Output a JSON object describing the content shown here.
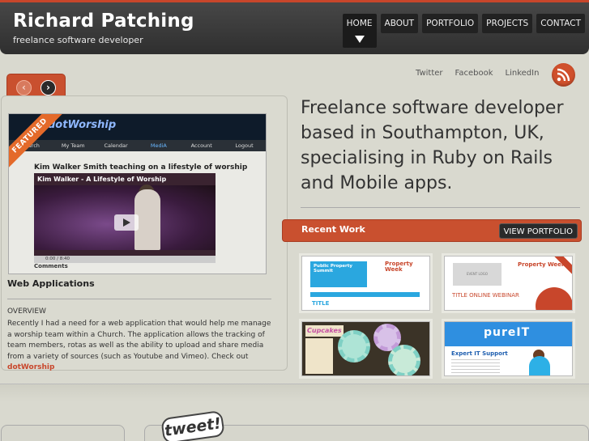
{
  "header": {
    "title": "Richard Patching",
    "subtitle": "freelance software developer",
    "nav": [
      "HOME",
      "ABOUT",
      "PORTFOLIO",
      "PROJECTS",
      "CONTACT"
    ]
  },
  "social": {
    "twitter": "Twitter",
    "facebook": "Facebook",
    "linkedin": "LinkedIn",
    "rss_icon": "rss-icon"
  },
  "slider": {
    "prev_icon": "chevron-left-icon",
    "next_icon": "chevron-right-icon"
  },
  "featured": {
    "ribbon": "FEATURED",
    "screenshot": {
      "brand": "dotWorship",
      "menu": [
        "Church",
        "My Team",
        "Calendar",
        "MediA",
        "Account",
        "Logout"
      ],
      "headline": "Kim Walker Smith teaching on a lifestyle of worship",
      "video_title": "Kim Walker - A Lifestyle of Worship",
      "time": "0:00 / 8:40",
      "comments": "Comments"
    },
    "title": "Web Applications",
    "overview_label": "OVERVIEW",
    "body": "Recently I had a need for a web application that would help me manage a worship team within a Church. The application allows the tracking of team members, rotas as well as the ability to upload and share media from a variety of sources (such as Youtube and Vimeo). Check out ",
    "link": "dotWorship"
  },
  "intro": "Freelance software developer based in Southampton, UK, specialising in Ruby on Rails and Mobile apps.",
  "recent": {
    "title": "Recent Work",
    "button": "VIEW PORTFOLIO",
    "thumbs": {
      "t1": {
        "box": "Public Property Summit",
        "brand": "Property Week",
        "label": "TITLE"
      },
      "t2": {
        "logo": "EVENT LOGO",
        "brand": "Property Week",
        "label": "TITLE ONLINE WEBINAR"
      },
      "t3": {
        "label": "Cupcakes"
      },
      "t4": {
        "banner": "pureIT",
        "label": "Expert IT Support"
      }
    }
  },
  "footer": {
    "tweet": "tweet!"
  }
}
